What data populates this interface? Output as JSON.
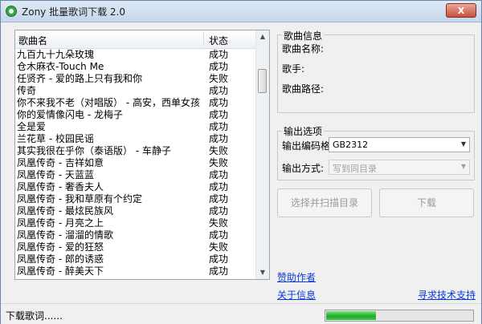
{
  "window": {
    "title": "Zony 批量歌词下载 2.0",
    "close_label": "X"
  },
  "list": {
    "header_name": "歌曲名",
    "header_status": "状态",
    "rows": [
      {
        "name": "九百九十九朵玫瑰",
        "status": "成功"
      },
      {
        "name": "仓木麻衣-Touch Me",
        "status": "成功"
      },
      {
        "name": "任贤齐 - 爱的路上只有我和你",
        "status": "失败"
      },
      {
        "name": "传奇",
        "status": "成功"
      },
      {
        "name": "你不来我不老（对唱版） - 高安，西单女孩",
        "status": "成功"
      },
      {
        "name": "你的爱情像闪电 - 龙梅子",
        "status": "成功"
      },
      {
        "name": "全是爱",
        "status": "成功"
      },
      {
        "name": "兰花草 - 校园民谣",
        "status": "成功"
      },
      {
        "name": "其实我很在乎你（泰语版） - 车静子",
        "status": "失败"
      },
      {
        "name": "凤凰传奇 - 吉祥如意",
        "status": "失败"
      },
      {
        "name": "凤凰传奇 - 天蓝蓝",
        "status": "成功"
      },
      {
        "name": "凤凰传奇 - 奢香夫人",
        "status": "成功"
      },
      {
        "name": "凤凰传奇 - 我和草原有个约定",
        "status": "成功"
      },
      {
        "name": "凤凰传奇 - 最炫民族风",
        "status": "成功"
      },
      {
        "name": "凤凰传奇 - 月亮之上",
        "status": "失败"
      },
      {
        "name": "凤凰传奇 - 溜溜的情歌",
        "status": "成功"
      },
      {
        "name": "凤凰传奇 - 爱的狂怒",
        "status": "失败"
      },
      {
        "name": "凤凰传奇 - 郎的诱惑",
        "status": "成功"
      },
      {
        "name": "凤凰传奇 - 醉美天下",
        "status": "成功"
      }
    ]
  },
  "song_info": {
    "section_title": "歌曲信息",
    "name_label": "歌曲名称:",
    "artist_label": "歌手:",
    "path_label": "歌曲路径:"
  },
  "output": {
    "section_title": "输出选项",
    "encoding_label": "输出编码格式:",
    "encoding_value": "GB2312",
    "mode_label": "输出方式:",
    "mode_value": "写到同目录"
  },
  "buttons": {
    "scan": "选择并扫描目录",
    "download": "下载"
  },
  "links": {
    "sponsor": "赞助作者",
    "about": "关于信息",
    "support": "寻求技术支持"
  },
  "statusbar": {
    "text": "下载歌词......",
    "progress": 0.34
  }
}
